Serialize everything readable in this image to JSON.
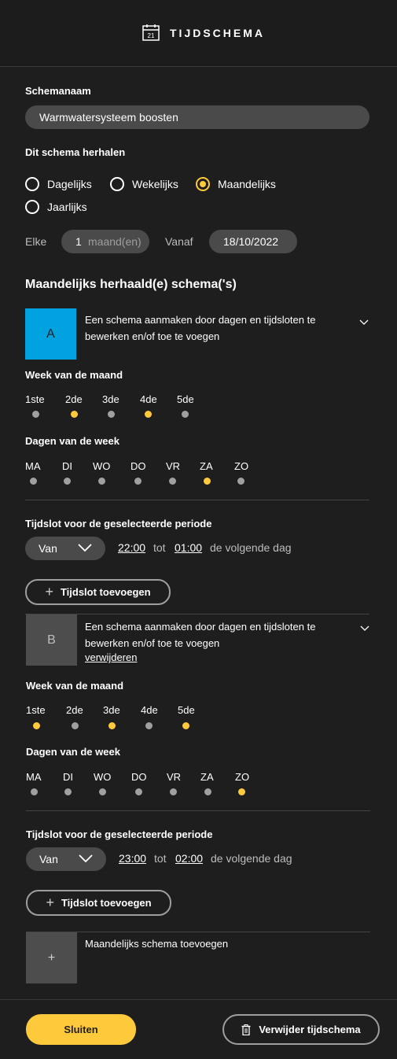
{
  "header": {
    "title": "TIJDSCHEMA",
    "icon": "calendar-icon",
    "icon_day": "21"
  },
  "schedule_name": {
    "label": "Schemanaam",
    "value": "Warmwatersysteem boosten"
  },
  "repeat": {
    "label": "Dit schema herhalen",
    "options": [
      {
        "label": "Dagelijks",
        "selected": false
      },
      {
        "label": "Wekelijks",
        "selected": false
      },
      {
        "label": "Maandelijks",
        "selected": true
      },
      {
        "label": "Jaarlijks",
        "selected": false
      }
    ],
    "every_label": "Elke",
    "every_value": "1",
    "every_unit": "maand(en)",
    "from_label": "Vanaf",
    "from_value": "18/10/2022"
  },
  "monthly_title": "Maandelijks herhaald(e) schema('s)",
  "schedules": [
    {
      "letter": "A",
      "color": "#00a3e0",
      "description_line1": "Een schema aanmaken door dagen en tijdsloten te",
      "description_line2": "bewerken en/of toe te voegen",
      "week_label": "Week van de maand",
      "weeks": [
        {
          "label": "1ste",
          "on": false
        },
        {
          "label": "2de",
          "on": true
        },
        {
          "label": "3de",
          "on": false
        },
        {
          "label": "4de",
          "on": true
        },
        {
          "label": "5de",
          "on": false
        }
      ],
      "days_label": "Dagen van de week",
      "days": [
        {
          "label": "MA",
          "on": false
        },
        {
          "label": "DI",
          "on": false
        },
        {
          "label": "WO",
          "on": false
        },
        {
          "label": "DO",
          "on": false
        },
        {
          "label": "VR",
          "on": false
        },
        {
          "label": "ZA",
          "on": true
        },
        {
          "label": "ZO",
          "on": false
        }
      ],
      "timeslot_label": "Tijdslot voor de geselecteerde periode",
      "slot_mode": "Van",
      "slot_start": "22:00",
      "slot_to": "tot",
      "slot_end": "01:00",
      "slot_suffix": "de volgende dag",
      "add_slot": "Tijdslot toevoegen"
    },
    {
      "letter": "B",
      "color": "#4d4d4d",
      "description_line1": "Een schema aanmaken door dagen en tijdsloten te",
      "description_line2": "bewerken en/of toe te voegen",
      "remove_link": "verwijderen",
      "week_label": "Week van de maand",
      "weeks": [
        {
          "label": "1ste",
          "on": true
        },
        {
          "label": "2de",
          "on": false
        },
        {
          "label": "3de",
          "on": true
        },
        {
          "label": "4de",
          "on": false
        },
        {
          "label": "5de",
          "on": true
        }
      ],
      "days_label": "Dagen van de week",
      "days": [
        {
          "label": "MA",
          "on": false
        },
        {
          "label": "DI",
          "on": false
        },
        {
          "label": "WO",
          "on": false
        },
        {
          "label": "DO",
          "on": false
        },
        {
          "label": "VR",
          "on": false
        },
        {
          "label": "ZA",
          "on": false
        },
        {
          "label": "ZO",
          "on": true
        }
      ],
      "timeslot_label": "Tijdslot voor de geselecteerde periode",
      "slot_mode": "Van",
      "slot_start": "23:00",
      "slot_to": "tot",
      "slot_end": "02:00",
      "slot_suffix": "de volgende dag",
      "add_slot": "Tijdslot toevoegen"
    }
  ],
  "add_schedule": {
    "symbol": "+",
    "label": "Maandelijks schema toevoegen"
  },
  "footer": {
    "close": "Sluiten",
    "delete": "Verwijder tijdschema"
  },
  "colors": {
    "accent": "#ffc93c",
    "background": "#1e1e1e",
    "field": "#4a4a4a"
  }
}
